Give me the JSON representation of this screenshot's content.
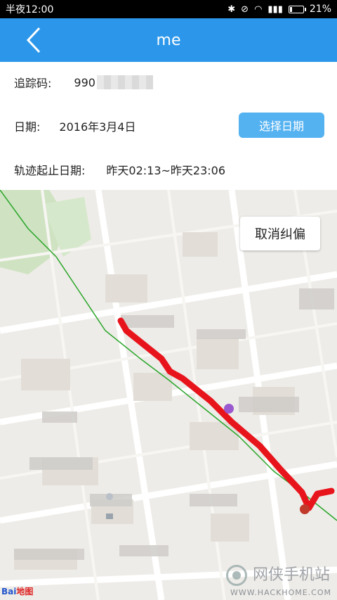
{
  "status_bar": {
    "time": "半夜12:00",
    "battery_text": "21%",
    "battery_level": 0.21
  },
  "header": {
    "title": "me"
  },
  "info": {
    "track_label": "追踪码:",
    "track_value_visible": "990",
    "date_label": "日期:",
    "date_value": "2016年3月4日",
    "pick_date_button": "选择日期",
    "range_label": "轨迹起止日期:",
    "range_value": "昨天02:13~昨天23:06"
  },
  "map": {
    "cancel_correction_button": "取消纠偏",
    "baidu_logo": "Bai",
    "baidu_logo_suffix": "地图",
    "watermark_text": "网侠手机站",
    "watermark_url": "WWW.HACKHOME.COM",
    "route_color": "#e8141c",
    "raw_track_color": "#2aa52a"
  },
  "colors": {
    "header_bg": "#2c97ea",
    "button_bg": "#55b2f1"
  }
}
